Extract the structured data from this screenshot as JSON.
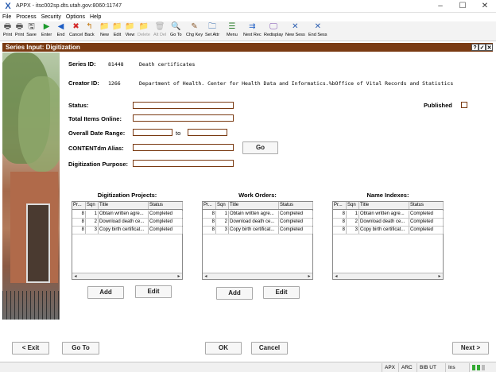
{
  "window": {
    "title": "APPX - itsc002sp.dts.utah.gov:8060:11747",
    "minimize": "–",
    "maximize": "☐",
    "close": "✕"
  },
  "menu": [
    "File",
    "Process",
    "Security",
    "Options",
    "Help"
  ],
  "toolbar": [
    {
      "label": "Print",
      "icon": "printer-icon",
      "glyph": "🖶",
      "disabled": false
    },
    {
      "label": "Print",
      "icon": "printer-icon",
      "glyph": "🖶",
      "disabled": false
    },
    {
      "label": "Save",
      "icon": "save-icon",
      "glyph": "🖫",
      "disabled": false
    },
    {
      "label": "Enter",
      "icon": "enter-arrow-icon",
      "glyph": "▶",
      "disabled": false
    },
    {
      "label": "End",
      "icon": "end-arrow-icon",
      "glyph": "◀",
      "disabled": false
    },
    {
      "label": "Cancel",
      "icon": "cancel-icon",
      "glyph": "✖",
      "disabled": false
    },
    {
      "label": "Back",
      "icon": "back-icon",
      "glyph": "↰",
      "disabled": false
    },
    {
      "label": "New",
      "icon": "new-folder-icon",
      "glyph": "📁",
      "disabled": false
    },
    {
      "label": "Edit",
      "icon": "edit-folder-icon",
      "glyph": "📁",
      "disabled": false
    },
    {
      "label": "View",
      "icon": "view-folder-icon",
      "glyph": "📁",
      "disabled": false
    },
    {
      "label": "Delete",
      "icon": "delete-icon",
      "glyph": "📁",
      "disabled": true
    },
    {
      "label": "Alt Del",
      "icon": "alt-delete-icon",
      "glyph": "🗑",
      "disabled": true
    },
    {
      "label": "Go To",
      "icon": "search-icon",
      "glyph": "🔍",
      "disabled": false
    },
    {
      "label": "Chg Key",
      "icon": "change-key-icon",
      "glyph": "✎",
      "disabled": false
    },
    {
      "label": "Set Attr",
      "icon": "set-attr-icon",
      "glyph": "🗀",
      "disabled": false
    },
    {
      "label": "Menu",
      "icon": "menu-icon",
      "glyph": "☰",
      "disabled": false
    },
    {
      "label": "Next Rec",
      "icon": "next-record-icon",
      "glyph": "⇉",
      "disabled": false
    },
    {
      "label": "Redisplay",
      "icon": "redisplay-icon",
      "glyph": "🖵",
      "disabled": false
    },
    {
      "label": "New Sess",
      "icon": "new-session-icon",
      "glyph": "✕",
      "disabled": false
    },
    {
      "label": "End Sess",
      "icon": "end-session-icon",
      "glyph": "✕",
      "disabled": false
    }
  ],
  "panel": {
    "title": "Series Input: Digitization",
    "buttons": [
      "?",
      "✓",
      "✕"
    ]
  },
  "form": {
    "series_id_label": "Series ID:",
    "series_id": "81448",
    "series_name": "Death certificates",
    "creator_id_label": "Creator ID:",
    "creator_id": "1266",
    "creator_name": "Department of Health. Center for Health Data and Informatics.%bOffice of Vital Records and Statistics",
    "status_label": "Status:",
    "status_value": "",
    "published_label": "Published",
    "total_items_label": "Total Items Online:",
    "total_items_value": "",
    "date_range_label": "Overall Date Range:",
    "date_from": "",
    "date_to_label": "to",
    "date_to": "",
    "alias_label": "CONTENTdm Alias:",
    "alias_value": "",
    "go_label": "Go",
    "purpose_label": "Digitization Purpose:",
    "purpose_value": ""
  },
  "grids": [
    {
      "title": "Digitization Projects:",
      "headers": [
        "Pr...",
        "Sqn",
        "Title",
        "Status"
      ],
      "rows": [
        [
          "8",
          "1",
          "Obtain written agre...",
          "Completed"
        ],
        [
          "8",
          "2",
          "Download death ce...",
          "Completed"
        ],
        [
          "8",
          "3",
          "Copy birth certificat...",
          "Completed"
        ]
      ],
      "add_label": "Add",
      "edit_label": "Edit"
    },
    {
      "title": "Work Orders:",
      "headers": [
        "Pr...",
        "Sqn",
        "Title",
        "Status"
      ],
      "rows": [
        [
          "8",
          "1",
          "Obtain written agre...",
          "Completed"
        ],
        [
          "8",
          "2",
          "Download death ce...",
          "Completed"
        ],
        [
          "8",
          "3",
          "Copy birth certificat...",
          "Completed"
        ]
      ],
      "add_label": "Add",
      "edit_label": "Edit"
    },
    {
      "title": "Name Indexes:",
      "headers": [
        "Pr...",
        "Sqn",
        "Title",
        "Status"
      ],
      "rows": [
        [
          "8",
          "1",
          "Obtain written agre...",
          "Completed"
        ],
        [
          "8",
          "2",
          "Download death ce...",
          "Completed"
        ],
        [
          "8",
          "3",
          "Copy birth certificat...",
          "Completed"
        ]
      ]
    }
  ],
  "footer": {
    "exit_label": "< Exit",
    "goto_label": "Go To",
    "ok_label": "OK",
    "cancel_label": "Cancel",
    "next_label": "Next >"
  },
  "statusbar": {
    "cells": [
      "APX",
      "ARC",
      "BIB UT",
      "Ins"
    ]
  }
}
